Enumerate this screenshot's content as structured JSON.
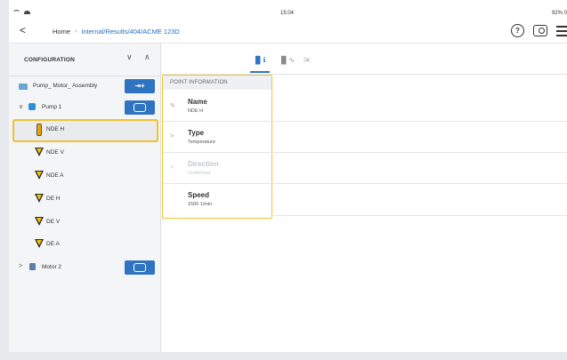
{
  "status_bar": {
    "time": "15:04",
    "battery": "92% 0"
  },
  "nav": {
    "back": "<",
    "breadcrumb": {
      "home": "Home",
      "separator": "›",
      "path": "Internal/Results/404/ACME 123D"
    }
  },
  "left_panel": {
    "title": "CONFIGURATION",
    "collapse_down": "∨",
    "collapse_up": "∧",
    "tree": {
      "assembly": {
        "label": "Pump_ Motor_ Assembly",
        "button": "⇥+"
      },
      "pump": {
        "label": "Pump 1",
        "expand": "∨"
      },
      "points": [
        {
          "label": "NDE H"
        },
        {
          "label": "NDE V"
        },
        {
          "label": "NDE A"
        },
        {
          "label": "DE H"
        },
        {
          "label": "DE V"
        },
        {
          "label": "DE A"
        }
      ],
      "motor": {
        "label": "Motor 2",
        "expand": ">"
      }
    }
  },
  "tabs": [
    {
      "icon": "▐▌ℹ",
      "active": true
    },
    {
      "icon": "▐▌∿",
      "active": false
    },
    {
      "icon": "⁞≡",
      "active": false
    }
  ],
  "point_info": {
    "header": "POINT INFORMATION",
    "rows": [
      {
        "title": "Name",
        "value": "NDE H",
        "icon": "✎",
        "enabled": true
      },
      {
        "title": "Type",
        "value": "Temperature",
        "icon": ">",
        "enabled": true
      },
      {
        "title": "Direction",
        "value": "Undefined",
        "icon": ">",
        "enabled": false
      },
      {
        "title": "Speed",
        "value": "1500 1/min",
        "icon": "",
        "enabled": true
      }
    ]
  },
  "colors": {
    "accent": "#2f74c0",
    "highlight": "#f0c330",
    "panel_bg": "#f4f5f7"
  }
}
